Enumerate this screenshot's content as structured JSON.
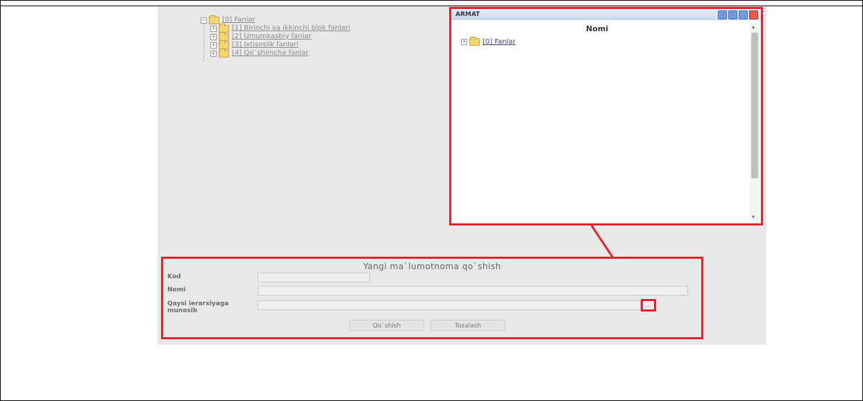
{
  "tree": {
    "root": "[0] Fanlar",
    "children": [
      "[1] Birinchi va ikkinchi blok fanlari",
      "[2] Umumkasbiy fanlar",
      "[3] Ixtisoslik fanlari",
      "[4] Qo`shimcha fanlar"
    ]
  },
  "popup": {
    "title": "ARMAT",
    "column_header": "Nomi",
    "root_item": "[0] Fanlar",
    "scroll_up": "▴",
    "scroll_down": "▾"
  },
  "form": {
    "title": "Yangi ma`lumotnoma qo`shish",
    "kod_label": "Kod",
    "nomi_label": "Nomi",
    "parent_label": "Qaysi ierarxiyaga munosib",
    "picker_label": "...",
    "add_button": "Qo`shish",
    "edit_button": "Tozalash"
  },
  "colors": {
    "highlight": "#e0232c",
    "panel_bg": "#e8e8e8"
  }
}
